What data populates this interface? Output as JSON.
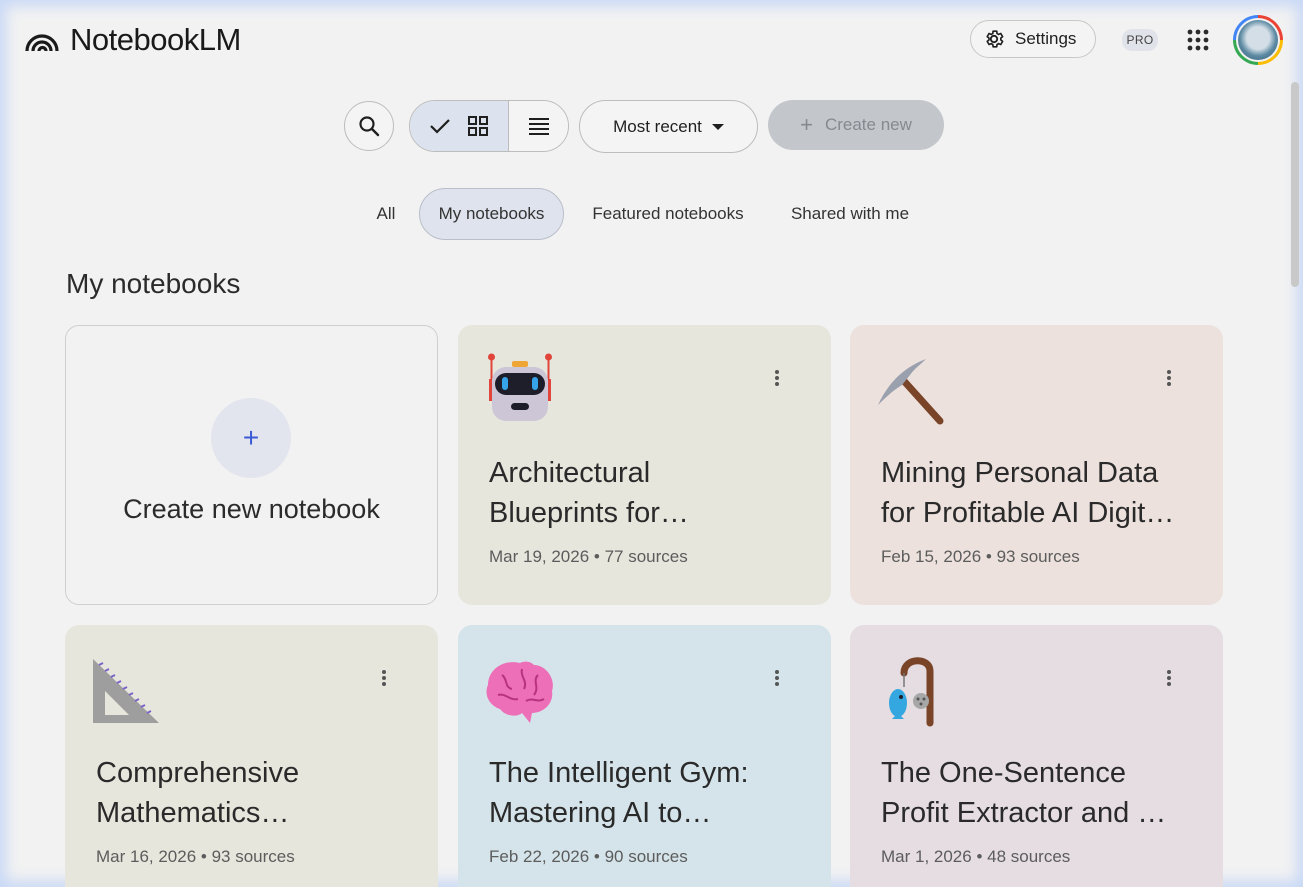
{
  "header": {
    "app_name": "NotebookLM",
    "settings_label": "Settings",
    "pro_badge": "PRO",
    "icons": {
      "logo": "notebooklm-logo-icon",
      "settings": "gear-icon",
      "apps": "apps-grid-icon",
      "avatar": "user-avatar"
    }
  },
  "toolbar": {
    "search_icon": "search-icon",
    "view_grid_icons": [
      "check-icon",
      "grid-view-icon"
    ],
    "view_list_icon": "list-view-icon",
    "sort_label": "Most recent",
    "create_label": "Create new"
  },
  "tabs": [
    {
      "label": "All",
      "active": false
    },
    {
      "label": "My notebooks",
      "active": true
    },
    {
      "label": "Featured notebooks",
      "active": false
    },
    {
      "label": "Shared with me",
      "active": false
    }
  ],
  "section": {
    "title": "My notebooks"
  },
  "create_card": {
    "label": "Create new notebook",
    "plus": "+"
  },
  "notebooks": [
    {
      "emoji_icon": "robot-icon",
      "title": "Architectural\nBlueprints for…",
      "meta": "Mar 19, 2026 • 77 sources",
      "bg": "#e7e6dd"
    },
    {
      "emoji_icon": "pick-icon",
      "title": "Mining Personal Data\nfor Profitable AI Digit…",
      "meta": "Feb 15, 2026 • 93 sources",
      "bg": "#ece1dd"
    },
    {
      "emoji_icon": "triangular-ruler-icon",
      "title": "Comprehensive\nMathematics…",
      "meta": "Mar 16, 2026 • 93 sources",
      "bg": "#e7e6dd"
    },
    {
      "emoji_icon": "brain-icon",
      "title": "The Intelligent Gym:\nMastering AI to…",
      "meta": "Feb 22, 2026 • 90 sources",
      "bg": "#d5e4ea"
    },
    {
      "emoji_icon": "fishing-pole-icon",
      "title": "The One-Sentence\nProfit Extractor and …",
      "meta": "Mar 1, 2026 • 48 sources",
      "bg": "#e5dde2"
    }
  ]
}
